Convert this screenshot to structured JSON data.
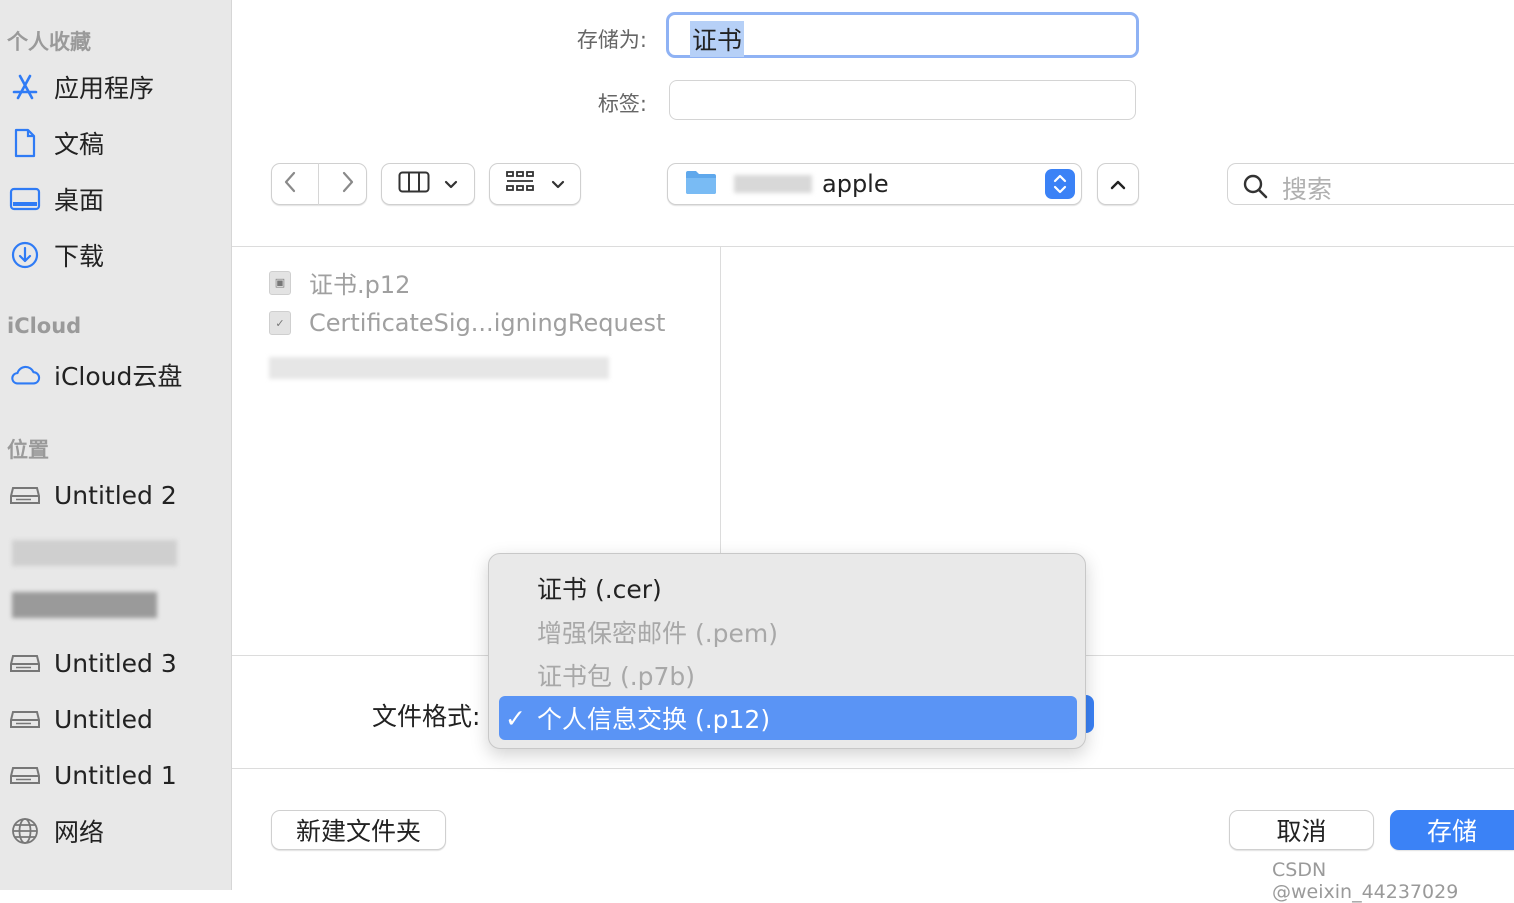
{
  "sidebar": {
    "favorites_title": "个人收藏",
    "favorites": [
      {
        "label": "应用程序",
        "icon": "app-store-icon"
      },
      {
        "label": "文稿",
        "icon": "document-icon"
      },
      {
        "label": "桌面",
        "icon": "desktop-icon"
      },
      {
        "label": "下载",
        "icon": "download-icon"
      }
    ],
    "icloud_title": "iCloud",
    "icloud_drive": "iCloud云盘",
    "locations_title": "位置",
    "locations": [
      "Untitled 2",
      "Untitled 3",
      "Untitled",
      "Untitled 1"
    ],
    "network": "网络"
  },
  "form": {
    "save_as_label": "存储为:",
    "save_as_value": "证书",
    "tags_label": "标签:",
    "tags_value": ""
  },
  "toolbar": {
    "location": "apple",
    "search_placeholder": "搜索"
  },
  "files": [
    {
      "name": "证书.p12"
    },
    {
      "name": "CertificateSig...igningRequest"
    }
  ],
  "format": {
    "label": "文件格式:",
    "options": [
      {
        "label": "证书 (.cer)",
        "enabled": true,
        "selected": false
      },
      {
        "label": "增强保密邮件 (.pem)",
        "enabled": false,
        "selected": false
      },
      {
        "label": "证书包 (.p7b)",
        "enabled": false,
        "selected": false
      },
      {
        "label": "个人信息交换 (.p12)",
        "enabled": true,
        "selected": true
      }
    ],
    "check_mark": "✓"
  },
  "buttons": {
    "new_folder": "新建文件夹",
    "cancel": "取消",
    "save": "存储"
  },
  "watermark": "CSDN @weixin_44237029",
  "colors": {
    "accent": "#3b82f6",
    "selection": "#5a94f5",
    "sidebar_bg": "#e8e8e8"
  }
}
